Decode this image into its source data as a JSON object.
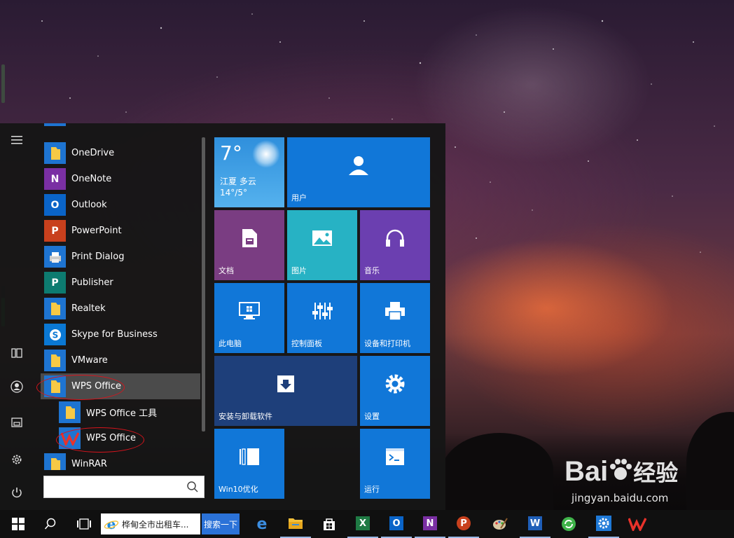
{
  "start_menu": {
    "app_list": [
      {
        "label": "OneDrive",
        "icon": "folder-icon",
        "tile_color": "#1e74d1"
      },
      {
        "label": "OneNote",
        "icon": "onenote-icon",
        "tile_color": "#7a2fa3"
      },
      {
        "label": "Outlook",
        "icon": "outlook-icon",
        "tile_color": "#0a64c8"
      },
      {
        "label": "PowerPoint",
        "icon": "powerpoint-icon",
        "tile_color": "#c8401d"
      },
      {
        "label": "Print Dialog",
        "icon": "printer-icon",
        "tile_color": "#1e74d1"
      },
      {
        "label": "Publisher",
        "icon": "publisher-icon",
        "tile_color": "#0d7b70"
      },
      {
        "label": "Realtek",
        "icon": "folder-icon",
        "tile_color": "#1e74d1"
      },
      {
        "label": "Skype for Business",
        "icon": "skype-icon",
        "tile_color": "#0a78d4"
      },
      {
        "label": "VMware",
        "icon": "folder-icon",
        "tile_color": "#1e74d1"
      },
      {
        "label": "WPS Office",
        "icon": "folder-icon",
        "tile_color": "#1e74d1",
        "selected": true
      },
      {
        "label": "WPS Office 工具",
        "icon": "folder-icon",
        "tile_color": "#1e74d1",
        "sub": true
      },
      {
        "label": "WPS Office",
        "icon": "wps-icon",
        "tile_color": "#1e74d1",
        "sub": true
      },
      {
        "label": "WinRAR",
        "icon": "folder-icon",
        "tile_color": "#1e74d1"
      }
    ],
    "search_placeholder": ""
  },
  "tiles": {
    "weather": {
      "temp": "7°",
      "city": "江夏",
      "cond": "多云",
      "range": "14°/5°"
    },
    "user": {
      "label": "用户"
    },
    "documents": {
      "label": "文档"
    },
    "pictures": {
      "label": "图片"
    },
    "music": {
      "label": "音乐"
    },
    "this_pc": {
      "label": "此电脑"
    },
    "control_panel": {
      "label": "控制面板"
    },
    "devices": {
      "label": "设备和打印机"
    },
    "install": {
      "label": "安装与卸载软件"
    },
    "settings": {
      "label": "设置"
    },
    "win10": {
      "label": "Win10优化"
    },
    "run": {
      "label": "运行"
    }
  },
  "taskbar": {
    "ie_text": "桦甸全市出租车...",
    "search_button": "搜索一下"
  },
  "watermark": {
    "brand": "Bai",
    "brand2": "经验",
    "url": "jingyan.baidu.com"
  },
  "colors": {
    "tile_blue": "#1177d8",
    "tile_purple": "#7a3d82",
    "tile_teal": "#27b2c4",
    "tile_violet": "#6b3fb0",
    "tile_navy": "#1e3f7a",
    "annotation": "#d8141c"
  }
}
